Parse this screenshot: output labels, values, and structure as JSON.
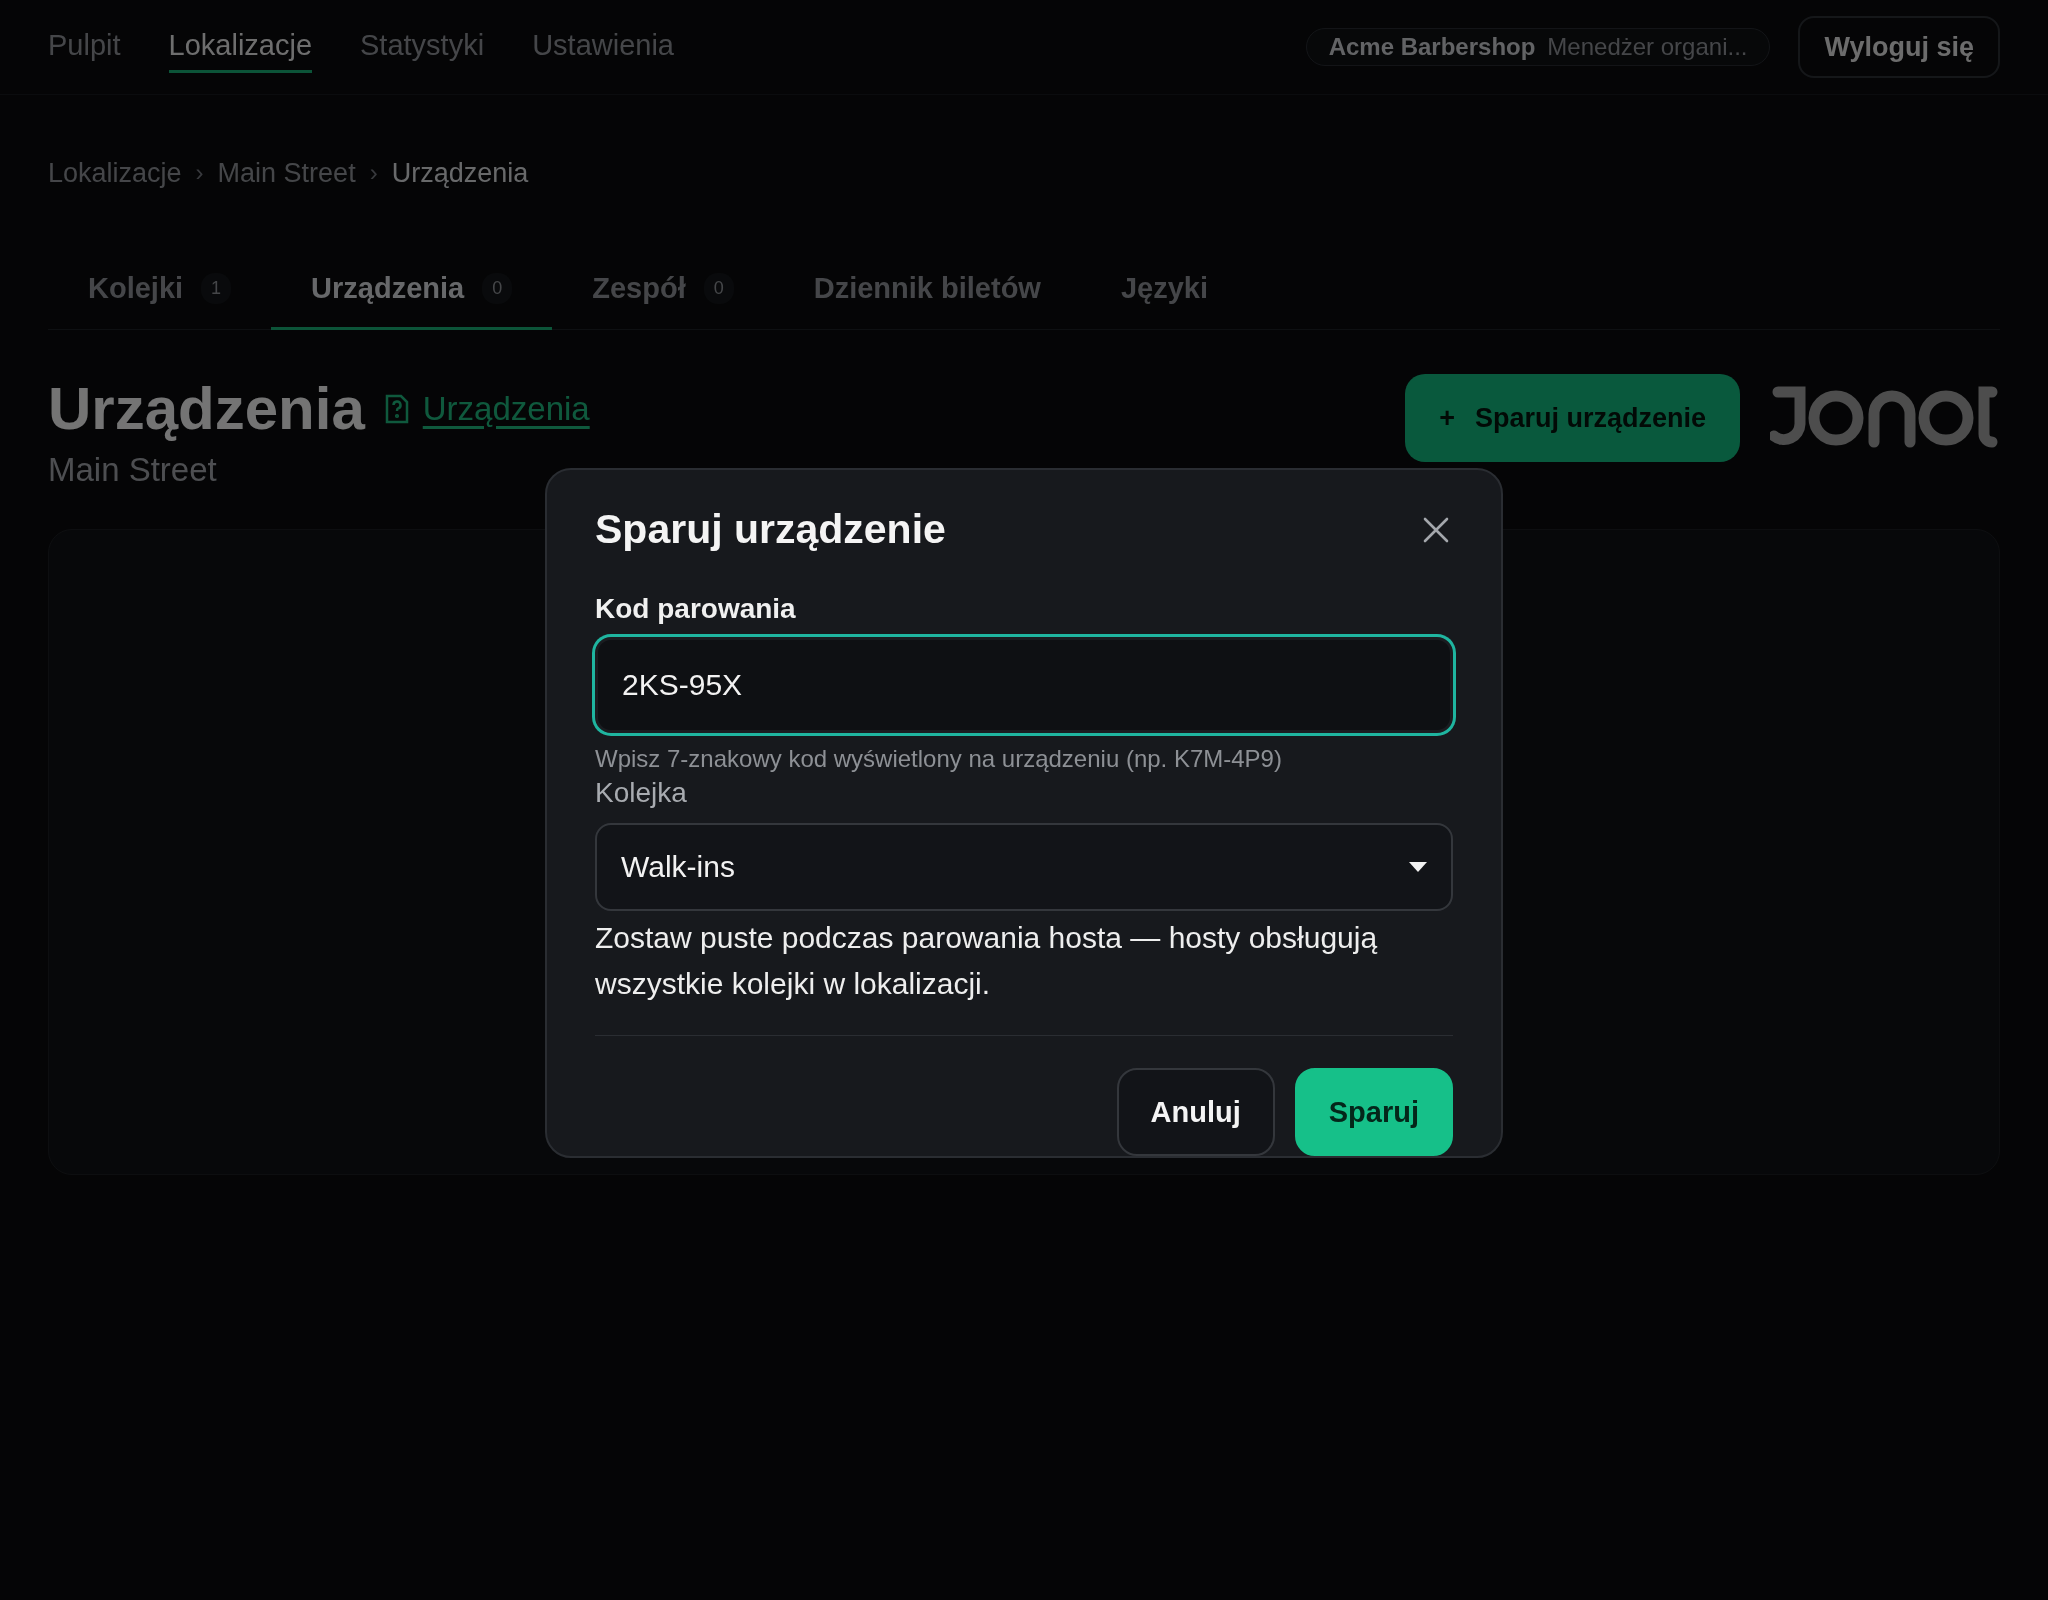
{
  "nav": {
    "items": [
      {
        "label": "Pulpit",
        "selected": false
      },
      {
        "label": "Lokalizacje",
        "selected": true
      },
      {
        "label": "Statystyki",
        "selected": false
      },
      {
        "label": "Ustawienia",
        "selected": false
      }
    ],
    "org": {
      "name": "Acme Barbershop",
      "role": "Menedżer organi..."
    },
    "logout": "Wyloguj się"
  },
  "breadcrumb": [
    {
      "label": "Lokalizacje",
      "current": false
    },
    {
      "label": "Main Street",
      "current": false
    },
    {
      "label": "Urządzenia",
      "current": true
    }
  ],
  "breadcrumb_separator": "›",
  "tabs": [
    {
      "label": "Kolejki",
      "count": "1",
      "selected": false
    },
    {
      "label": "Urządzenia",
      "count": "0",
      "selected": true
    },
    {
      "label": "Zespół",
      "count": "0",
      "selected": false
    },
    {
      "label": "Dziennik biletów",
      "selected": false
    },
    {
      "label": "Języki",
      "selected": false
    }
  ],
  "header": {
    "title": "Urządzenia",
    "help_link": "Urządzenia",
    "subtitle": "Main Street",
    "add_button": {
      "icon": "+",
      "label": "Sparuj urządzenie"
    }
  },
  "dialog": {
    "title": "Sparuj urządzenie",
    "code_field": {
      "label": "Kod parowania",
      "value": "2KS-95X",
      "focused": true,
      "hint": "Wpisz 7-znakowy kod wyświetlony na urządzeniu (np. K7M-4P9)"
    },
    "queue_field": {
      "label": "Kolejka",
      "value": "Walk-ins",
      "help": "Zostaw puste podczas parowania hosta — hosty obsługują wszystkie kolejki w lokalizacji."
    },
    "buttons": [
      {
        "label": "Anuluj",
        "kind": "secondary"
      },
      {
        "label": "Sparuj",
        "kind": "primary"
      }
    ]
  }
}
